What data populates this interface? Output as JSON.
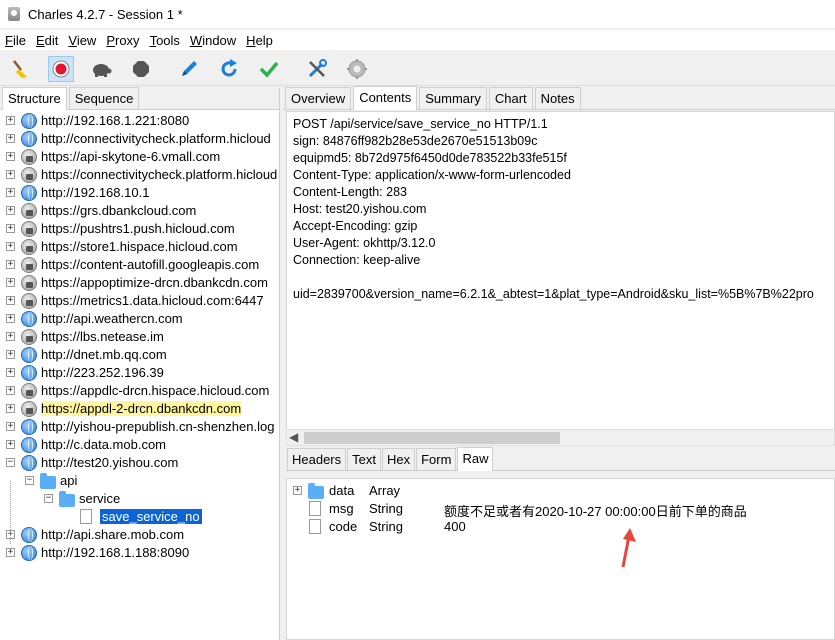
{
  "window": {
    "title": "Charles 4.2.7 - Session 1 *"
  },
  "menu": [
    {
      "u": "F",
      "rest": "ile"
    },
    {
      "u": "E",
      "rest": "dit"
    },
    {
      "u": "V",
      "rest": "iew"
    },
    {
      "u": "P",
      "rest": "roxy"
    },
    {
      "u": "T",
      "rest": "ools"
    },
    {
      "u": "W",
      "rest": "indow"
    },
    {
      "u": "H",
      "rest": "elp"
    }
  ],
  "toolbar": [
    "broom-icon",
    "record-icon",
    "turtle-icon",
    "stop-icon",
    "pen-icon",
    "refresh-icon",
    "check-icon",
    "tools-icon",
    "settings-icon"
  ],
  "left_tabs": [
    "Structure",
    "Sequence"
  ],
  "hosts": [
    {
      "label": "http://192.168.1.221:8080",
      "secure": false
    },
    {
      "label": "http://connectivitycheck.platform.hicloud",
      "secure": false
    },
    {
      "label": "https://api-skytone-6.vmall.com",
      "secure": true
    },
    {
      "label": "https://connectivitycheck.platform.hicloud",
      "secure": true
    },
    {
      "label": "http://192.168.10.1",
      "secure": false
    },
    {
      "label": "https://grs.dbankcloud.com",
      "secure": true
    },
    {
      "label": "https://pushtrs1.push.hicloud.com",
      "secure": true
    },
    {
      "label": "https://store1.hispace.hicloud.com",
      "secure": true
    },
    {
      "label": "https://content-autofill.googleapis.com",
      "secure": true
    },
    {
      "label": "https://appoptimize-drcn.dbankcdn.com",
      "secure": true
    },
    {
      "label": "https://metrics1.data.hicloud.com:6447",
      "secure": true
    },
    {
      "label": "http://api.weathercn.com",
      "secure": false
    },
    {
      "label": "https://lbs.netease.im",
      "secure": true
    },
    {
      "label": "http://dnet.mb.qq.com",
      "secure": false
    },
    {
      "label": "http://223.252.196.39",
      "secure": false
    },
    {
      "label": "https://appdlc-drcn.hispace.hicloud.com",
      "secure": true
    },
    {
      "label": "https://appdl-2-drcn.dbankcdn.com",
      "secure": true,
      "highlight": true
    },
    {
      "label": "http://yishou-prepublish.cn-shenzhen.log",
      "secure": false
    },
    {
      "label": "http://c.data.mob.com",
      "secure": false
    },
    {
      "label": "http://test20.yishou.com",
      "secure": false,
      "expanded": true
    }
  ],
  "tree_children": {
    "api": "api",
    "service": "service",
    "endpoint": "save_service_no"
  },
  "hosts_after": [
    {
      "label": "http://api.share.mob.com",
      "secure": false
    },
    {
      "label": "http://192.168.1.188:8090",
      "secure": false
    }
  ],
  "right_tabs": [
    "Overview",
    "Contents",
    "Summary",
    "Chart",
    "Notes"
  ],
  "request_lines": [
    "POST /api/service/save_service_no HTTP/1.1",
    "sign: 84876ff982b28e53de2670e51513b09c",
    "equipmd5: 8b72d975f6450d0de783522b33fe515f",
    "Content-Type: application/x-www-form-urlencoded",
    "Content-Length: 283",
    "Host: test20.yishou.com",
    "Accept-Encoding: gzip",
    "User-Agent: okhttp/3.12.0",
    "Connection: keep-alive",
    "",
    "uid=2839700&version_name=6.2.1&_abtest=1&plat_type=Android&sku_list=%5B%7B%22pro"
  ],
  "bottom_tabs": [
    "Headers",
    "Text",
    "Hex",
    "Form",
    "Raw"
  ],
  "json_tree": [
    {
      "key": "data",
      "type": "Array",
      "value": "",
      "kind": "folder"
    },
    {
      "key": "msg",
      "type": "String",
      "value": "额度不足或者有2020-10-27 00:00:00日前下单的商品",
      "kind": "file"
    },
    {
      "key": "code",
      "type": "String",
      "value": "400",
      "kind": "file"
    }
  ],
  "colors": {
    "selection": "#0a64d6",
    "highlight": "#fff69e",
    "annotation_arrow": "#e8463b"
  }
}
